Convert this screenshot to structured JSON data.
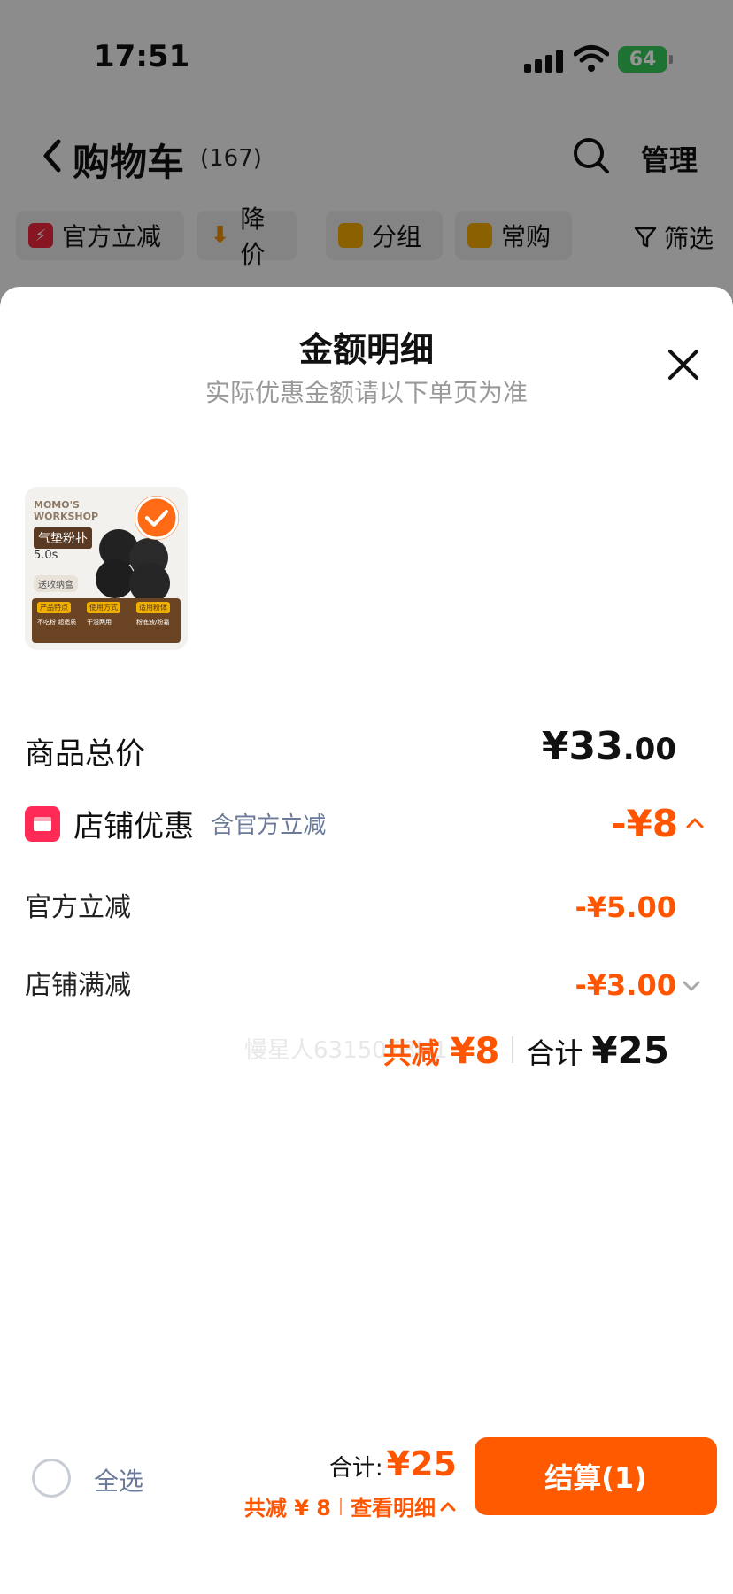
{
  "status": {
    "time": "17:51",
    "battery": "64"
  },
  "nav": {
    "title": "购物车",
    "count": "(167)",
    "manage": "管理"
  },
  "chips": [
    {
      "label": "官方立减",
      "icon": "lightning-icon",
      "color": "#e8263c"
    },
    {
      "label": "降价",
      "icon": "arrow-down-icon",
      "color": "#e88a00"
    },
    {
      "label": "分组",
      "icon": "folder-icon",
      "color": "#f0a500"
    },
    {
      "label": "常购",
      "icon": "bag-icon",
      "color": "#f0a500"
    }
  ],
  "filter": {
    "label": "筛选"
  },
  "sheet": {
    "title": "金额明细",
    "subtitle": "实际优惠金额请以下单页为准"
  },
  "product": {
    "brand": "MOMO'S WORKSHOP",
    "name": "气垫粉扑",
    "size": "5.0s",
    "tag": "送收纳盒",
    "features": [
      "产品特点",
      "使用方式",
      "适用粉体"
    ],
    "feature_details": [
      "不吃粉 超适质",
      "干湿两用",
      "粉底液/粉霜"
    ]
  },
  "breakdown": {
    "total_label": "商品总价",
    "total_symbol": "¥",
    "total_int": "33",
    "total_dec": ".00",
    "store_label": "店铺优惠",
    "store_note": "含官方立减",
    "store_amount": "-¥8",
    "official_label": "官方立减",
    "official_amount": "-¥5.00",
    "full_label": "店铺满减",
    "full_amount": "-¥3.00"
  },
  "summary": {
    "saved_label": "共减",
    "saved_amount": "¥8",
    "total_label": "合计",
    "total_amount": "¥25"
  },
  "watermark": "慢星人6315078N1",
  "bottom": {
    "select_all": "全选",
    "sum_label": "合计:",
    "sum_amount": "¥25",
    "saved": "共减 ¥ 8",
    "view_detail": "查看明细",
    "checkout": "结算(1)"
  },
  "colors": {
    "accent": "#ff5500",
    "button": "#ff5a00",
    "store": "#ff2a55"
  }
}
